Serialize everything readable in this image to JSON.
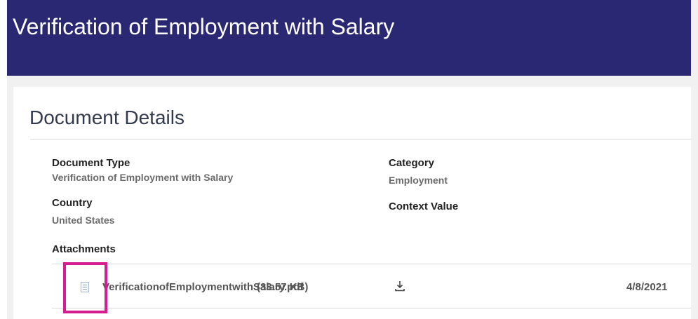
{
  "header": {
    "title": "Verification of Employment with Salary"
  },
  "section": {
    "title": "Document Details"
  },
  "fields": {
    "document_type": {
      "label": "Document Type",
      "value": "Verification of Employment with Salary"
    },
    "category": {
      "label": "Category",
      "value": "Employment"
    },
    "country": {
      "label": "Country",
      "value": "United States"
    },
    "context_value": {
      "label": "Context Value",
      "value": ""
    }
  },
  "attachments": {
    "label": "Attachments",
    "items": [
      {
        "icon": "document-icon",
        "file_name": "VerificationofEmploymentwithSalary.pdf",
        "file_size": "(33.57 KB)",
        "download_icon": "download-icon",
        "date": "4/8/2021"
      }
    ]
  },
  "colors": {
    "banner": "#2a2873",
    "highlight": "#d61d8f",
    "background": "#f1f1f1"
  }
}
